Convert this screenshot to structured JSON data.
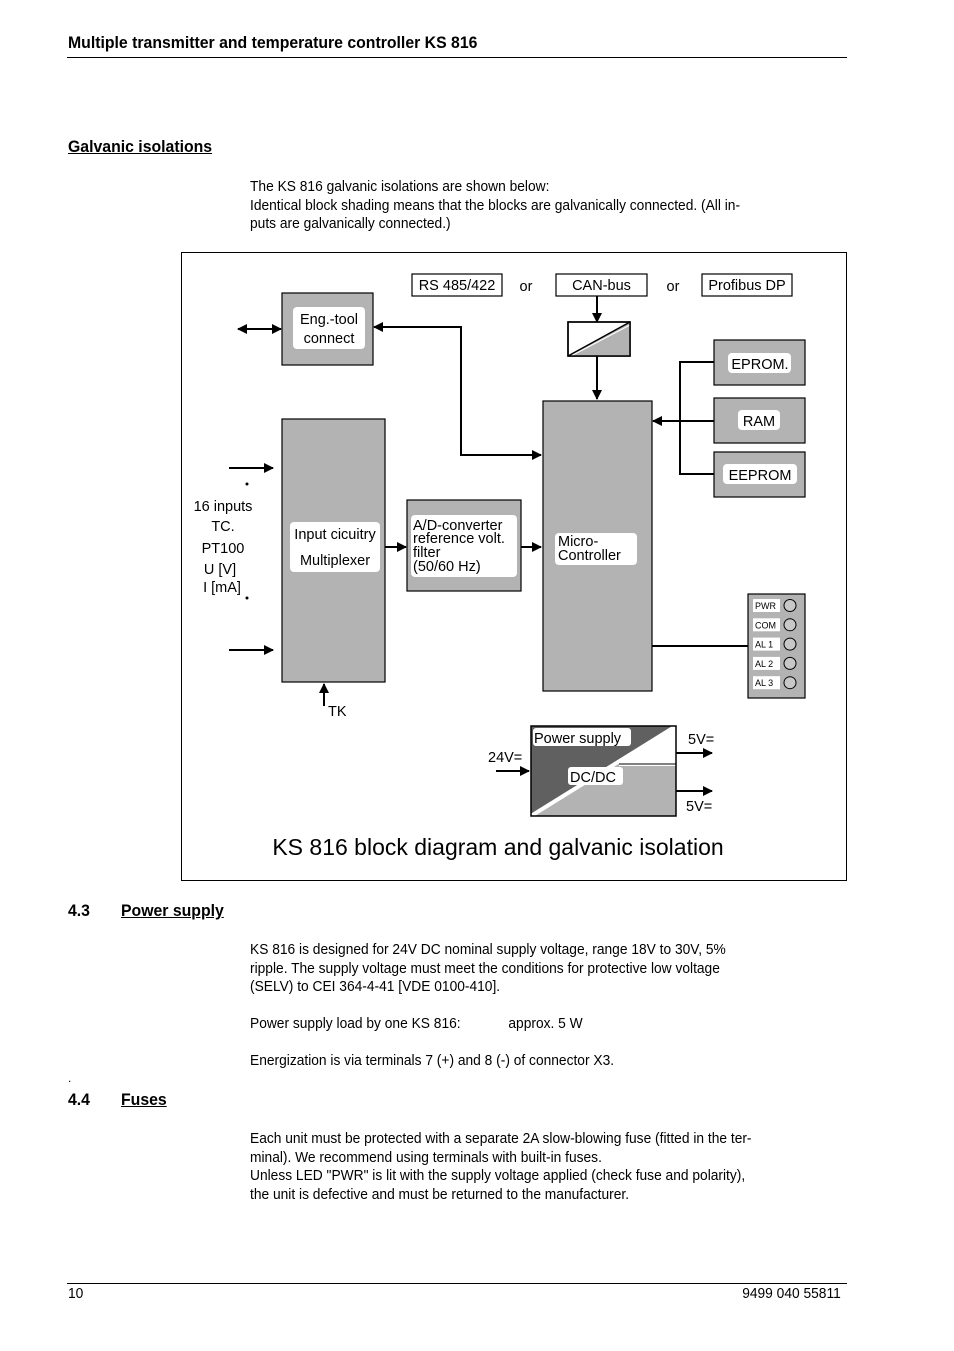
{
  "header": {
    "title": "Multiple transmitter and temperature controller KS 816"
  },
  "sections": {
    "galvanic": {
      "heading": "Galvanic isolations",
      "paragraph_1": "The KS 816 galvanic isolations are shown below:",
      "paragraph_2": "Identical block shading means that the blocks are galvanically connected. (All in-",
      "paragraph_3": "puts are galvanically connected.)"
    },
    "power_supply": {
      "number": "4.3",
      "heading": "Power supply",
      "lines": [
        "KS 816 is designed for 24V DC nominal supply voltage, range 18V to 30V, 5%",
        "ripple. The supply voltage must meet the conditions for protective low voltage",
        "(SELV) to CEI 364-4-41 [VDE 0100-410]."
      ],
      "load_label": "Power supply load by one KS 816:",
      "load_value": "approx. 5 W",
      "energization": "Energization is via terminals 7 (+) and 8 (-) of connector X3."
    },
    "stray_dot": ".",
    "fuses": {
      "number": "4.4",
      "heading": "Fuses",
      "lines": [
        "Each unit must be protected with a separate 2A slow-blowing fuse (fitted in the ter-",
        "minal). We recommend using terminals with built-in fuses.",
        "Unless LED \"PWR\" is lit with the supply voltage applied (check fuse and polarity),",
        "the unit is defective and must be returned to the manufacturer."
      ]
    }
  },
  "diagram": {
    "caption": "KS 816 block diagram and galvanic isolation",
    "bus_options": [
      "RS 485/422",
      "CAN-bus",
      "Profibus DP"
    ],
    "or_label": "or",
    "eng_tool": [
      "Eng.-tool",
      "connect"
    ],
    "inputs_label": [
      "16 inputs",
      "TC.",
      "PT100",
      "U [V]",
      "I [mA]"
    ],
    "input_block": [
      "Input cicuitry",
      "Multiplexer"
    ],
    "tk_label": "TK",
    "adc_block": [
      "A/D-converter",
      "reference volt.",
      "filter",
      "(50/60 Hz)"
    ],
    "micro_block": [
      "Micro-",
      "Controller"
    ],
    "memory": [
      "EPROM.",
      "RAM",
      "EEPROM"
    ],
    "leds": [
      "PWR",
      "COM",
      "AL 1",
      "AL 2",
      "AL 3"
    ],
    "power_block": {
      "title": "Power supply",
      "subtitle": "DC/DC",
      "input": "24V=",
      "output_1": "5V=",
      "output_2": "5V="
    },
    "colors": {
      "block_gray": "#b3b3b3",
      "dark_gray": "#606060"
    }
  },
  "footer": {
    "page_number": "10",
    "doc_number": "9499 040 55811"
  }
}
